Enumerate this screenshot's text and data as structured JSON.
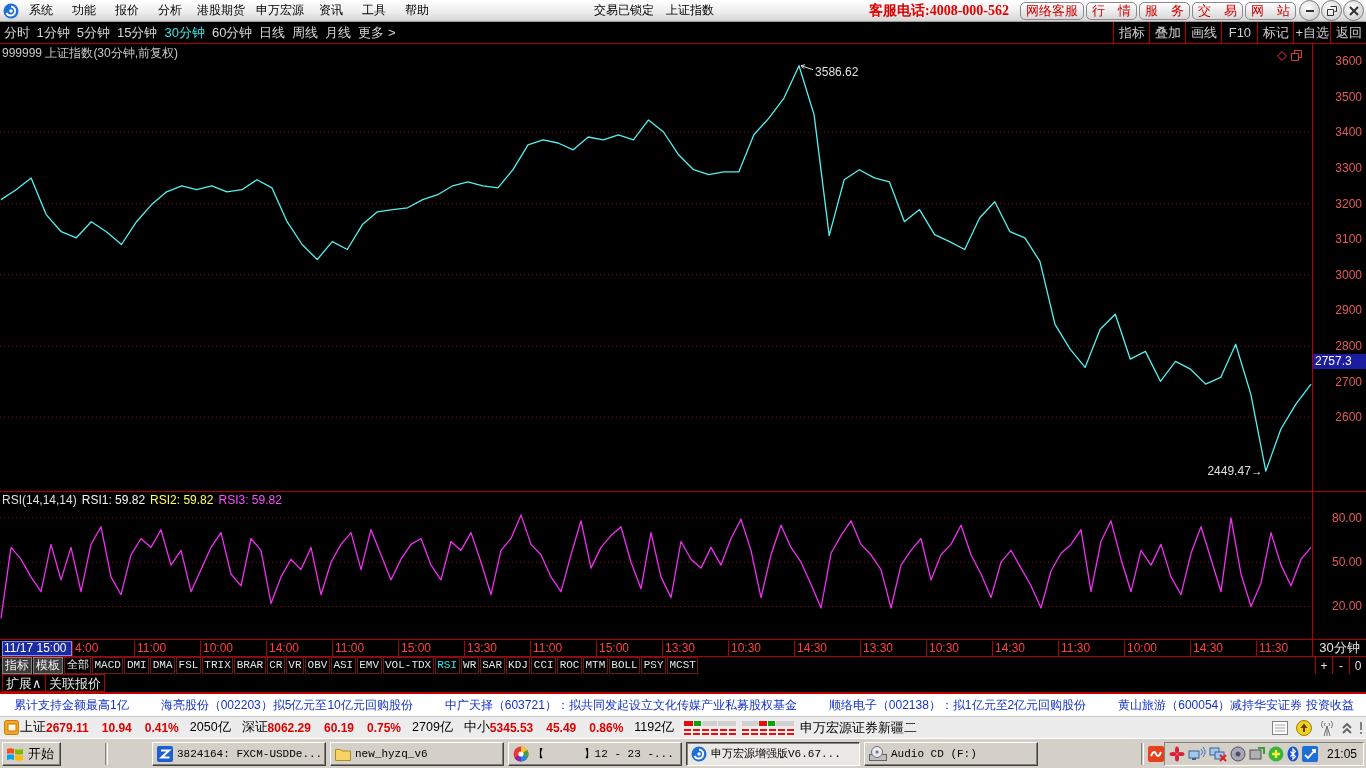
{
  "title_bar": {
    "menus": [
      "系统",
      "功能",
      "报价",
      "分析",
      "港股期货",
      "申万宏源",
      "资讯",
      "工具",
      "帮助"
    ],
    "status": [
      "交易已锁定",
      "上证指数"
    ],
    "hotline": "客服电话:4008-000-562",
    "links": [
      "网络客服",
      "行　情",
      "服　务",
      "交　易",
      "网　站"
    ]
  },
  "periods": [
    {
      "label": "分时",
      "selected": false
    },
    {
      "label": "1分钟",
      "selected": false
    },
    {
      "label": "5分钟",
      "selected": false
    },
    {
      "label": "15分钟",
      "selected": false
    },
    {
      "label": "30分钟",
      "selected": true
    },
    {
      "label": "60分钟",
      "selected": false
    },
    {
      "label": "日线",
      "selected": false
    },
    {
      "label": "周线",
      "selected": false
    },
    {
      "label": "月线",
      "selected": false
    },
    {
      "label": "更多 >",
      "selected": false
    }
  ],
  "tools": [
    "指标",
    "叠加",
    "画线",
    "F10",
    "标记",
    "+自选",
    "返回"
  ],
  "price_chart": {
    "cursor_label": "2757.3",
    "chart_data": {
      "type": "line",
      "title": "999999 上证指数(30分钟,前复权)",
      "series": [
        {
          "color": "#54f0f0",
          "values": [
            3211,
            3239,
            3272,
            3169,
            3121,
            3104,
            3149,
            3121,
            3085,
            3149,
            3197,
            3233,
            3250,
            3239,
            3250,
            3233,
            3239,
            3267,
            3244,
            3149,
            3085,
            3043,
            3093,
            3071,
            3141,
            3177,
            3183,
            3188,
            3211,
            3225,
            3250,
            3261,
            3250,
            3244,
            3295,
            3365,
            3379,
            3370,
            3351,
            3387,
            3379,
            3393,
            3379,
            3435,
            3401,
            3337,
            3295,
            3281,
            3289,
            3289,
            3393,
            3440,
            3496,
            3587,
            3449,
            3110,
            3267,
            3295,
            3272,
            3261,
            3149,
            3183,
            3113,
            3093,
            3071,
            3160,
            3205,
            3121,
            3104,
            3037,
            2861,
            2791,
            2740,
            2847,
            2889,
            2763,
            2785,
            2701,
            2757,
            2735,
            2693,
            2712,
            2805,
            2665,
            2449,
            2567,
            2637,
            2693
          ]
        }
      ],
      "ylim": [
        2393,
        3648
      ],
      "yticks": [
        2600,
        2700,
        2800,
        2900,
        3000,
        3100,
        3200,
        3300,
        3400,
        3500,
        3600
      ],
      "grid": true,
      "annotations": [
        "3586.62",
        "2449.47→"
      ]
    }
  },
  "rsi_chart": {
    "legend": [
      {
        "label": "RSI(14,14,14)",
        "color": "#e0e0e0"
      },
      {
        "label": "RSI1: 59.82",
        "color": "#f4f4f4"
      },
      {
        "label": "RSI2: 59.82",
        "color": "#ffff50"
      },
      {
        "label": "RSI3: 59.82",
        "color": "#ff50ff"
      }
    ],
    "chart_data": {
      "type": "line",
      "series": [
        {
          "color": "#f030f0",
          "values": [
            12,
            60,
            52,
            40,
            30,
            62,
            38,
            60,
            30,
            62,
            74,
            40,
            28,
            55,
            66,
            60,
            72,
            48,
            58,
            30,
            45,
            60,
            70,
            42,
            34,
            66,
            58,
            22,
            40,
            52,
            45,
            60,
            28,
            50,
            62,
            70,
            45,
            72,
            55,
            38,
            52,
            62,
            66,
            48,
            38,
            64,
            58,
            70,
            50,
            28,
            58,
            66,
            82,
            62,
            55,
            40,
            30,
            55,
            78,
            46,
            60,
            68,
            74,
            50,
            32,
            70,
            40,
            26,
            64,
            52,
            46,
            60,
            48,
            66,
            79,
            58,
            26,
            55,
            75,
            60,
            50,
            35,
            19,
            56,
            68,
            78,
            62,
            55,
            45,
            19,
            48,
            58,
            66,
            38,
            55,
            62,
            75,
            55,
            42,
            26,
            50,
            58,
            46,
            34,
            19,
            44,
            56,
            62,
            72,
            30,
            64,
            78,
            52,
            30,
            58,
            48,
            62,
            40,
            28,
            56,
            74,
            52,
            30,
            80,
            42,
            20,
            36,
            70,
            48,
            34,
            52,
            60
          ]
        }
      ],
      "ylim": [
        -2,
        97.5
      ],
      "yticks": [
        {
          "value": 20,
          "label": "20.00"
        },
        {
          "value": 50,
          "label": "50.00"
        },
        {
          "value": 80,
          "label": "80.00"
        }
      ],
      "grid": true
    }
  },
  "time_axis": {
    "cursor_label": "11/17 15:00",
    "labels": [
      "4:00",
      "11:00",
      "10:00",
      "14:00",
      "11:00",
      "15:00",
      "13:30",
      "11:00",
      "15:00",
      "13:30",
      "10:30",
      "14:30",
      "13:30",
      "10:30",
      "14:30",
      "11:30",
      "10:00",
      "14:30",
      "11:30"
    ],
    "unit": "30分钟"
  },
  "panel_buttons": [
    "指标",
    "模板"
  ],
  "indicators": [
    {
      "label": "全部",
      "selected": false
    },
    {
      "label": "MACD",
      "selected": false
    },
    {
      "label": "DMI",
      "selected": false
    },
    {
      "label": "DMA",
      "selected": false
    },
    {
      "label": "FSL",
      "selected": false
    },
    {
      "label": "TRIX",
      "selected": false
    },
    {
      "label": "BRAR",
      "selected": false
    },
    {
      "label": "CR",
      "selected": false
    },
    {
      "label": "VR",
      "selected": false
    },
    {
      "label": "OBV",
      "selected": false
    },
    {
      "label": "ASI",
      "selected": false
    },
    {
      "label": "EMV",
      "selected": false
    },
    {
      "label": "VOL-TDX",
      "selected": false
    },
    {
      "label": "RSI",
      "selected": true
    },
    {
      "label": "WR",
      "selected": false
    },
    {
      "label": "SAR",
      "selected": false
    },
    {
      "label": "KDJ",
      "selected": false
    },
    {
      "label": "CCI",
      "selected": false
    },
    {
      "label": "ROC",
      "selected": false
    },
    {
      "label": "MTM",
      "selected": false
    },
    {
      "label": "BOLL",
      "selected": false
    },
    {
      "label": "PSY",
      "selected": false
    },
    {
      "label": "MCST",
      "selected": false
    }
  ],
  "zoom_buttons": [
    "+",
    "-",
    "0"
  ],
  "extension_tabs": [
    "扩展∧",
    "关联报价"
  ],
  "news_ticker": [
    "累计支持金额最高1亿",
    "海亮股份（002203）拟5亿元至10亿元回购股份",
    "中广天择（603721）：拟共同发起设立文化传媒产业私募股权基金",
    "顺络电子（002138）：拟1亿元至2亿元回购股份",
    "黄山旅游（600054）减持华安证券 投资收益"
  ],
  "status_bar": {
    "indices": [
      {
        "name": "上证",
        "value": "2679.11",
        "change": "10.94",
        "percent": "0.41%",
        "amount": "2050亿",
        "rising": true
      },
      {
        "name": "深证",
        "value": "8062.29",
        "change": "60.19",
        "percent": "0.75%",
        "amount": "2709亿",
        "rising": true
      },
      {
        "name": "中小",
        "value": "5345.53",
        "change": "45.49",
        "percent": "0.86%",
        "amount": "1192亿",
        "rising": true
      }
    ],
    "broker": "申万宏源证券新疆二"
  },
  "taskbar": {
    "start": "开始",
    "tasks": [
      {
        "label": "3824164: FXCM-USDDe...",
        "kind": "terminal",
        "selected": false
      },
      {
        "label": "new_hyzq_v6",
        "kind": "folder",
        "selected": false
      },
      {
        "label": "【      】12 - 23 -...",
        "kind": "browser",
        "selected": false
      },
      {
        "label": "申万宏源增强版V6.67...",
        "kind": "app",
        "selected": true
      },
      {
        "label": "Audio CD (F:)",
        "kind": "drive",
        "selected": false
      }
    ],
    "clock": "21:05"
  }
}
